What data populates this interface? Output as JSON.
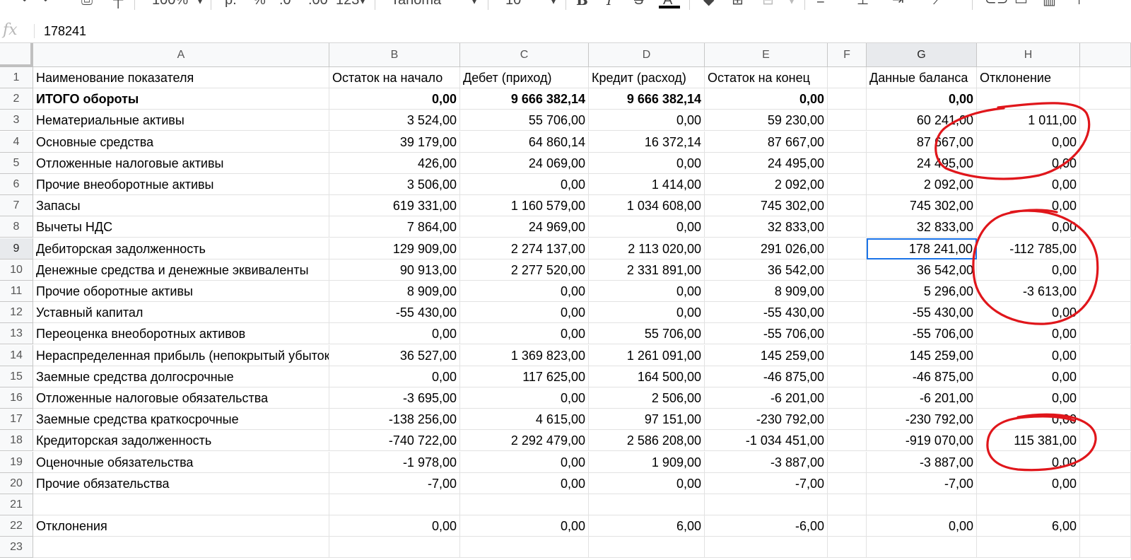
{
  "toolbar": {
    "zoom": "100%",
    "currency": "р.",
    "percent": "%",
    "dec_less": ".0",
    "dec_more": ".00",
    "number_format": "123",
    "font": "Tahoma",
    "font_size": "10",
    "bold": "B",
    "italic": "I",
    "strike": "S",
    "text_color": "A"
  },
  "formula_bar": {
    "fx": "fx",
    "value": "178241"
  },
  "columns": [
    {
      "id": "A",
      "label": "A"
    },
    {
      "id": "B",
      "label": "B"
    },
    {
      "id": "C",
      "label": "C"
    },
    {
      "id": "D",
      "label": "D"
    },
    {
      "id": "E",
      "label": "E"
    },
    {
      "id": "F",
      "label": "F"
    },
    {
      "id": "G",
      "label": "G"
    },
    {
      "id": "H",
      "label": "H"
    }
  ],
  "rows": [
    {
      "n": "1",
      "cells": [
        "Наименование показателя",
        "Остаток на начало",
        "Дебет (приход)",
        "Кредит (расход)",
        "Остаток на конец",
        "",
        "Данные баланса",
        "Отклонение"
      ]
    },
    {
      "n": "2",
      "cells": [
        "ИТОГО обороты",
        "0,00",
        "9 666 382,14",
        "9 666 382,14",
        "0,00",
        "",
        "0,00",
        ""
      ]
    },
    {
      "n": "3",
      "cells": [
        "Нематериальные активы",
        "3 524,00",
        "55 706,00",
        "0,00",
        "59 230,00",
        "",
        "60 241,00",
        "1 011,00"
      ]
    },
    {
      "n": "4",
      "cells": [
        "Основные средства",
        "39 179,00",
        "64 860,14",
        "16 372,14",
        "87 667,00",
        "",
        "87 667,00",
        "0,00"
      ]
    },
    {
      "n": "5",
      "cells": [
        "Отложенные налоговые активы",
        "426,00",
        "24 069,00",
        "0,00",
        "24 495,00",
        "",
        "24 495,00",
        "0,00"
      ]
    },
    {
      "n": "6",
      "cells": [
        "Прочие внеоборотные активы",
        "3 506,00",
        "0,00",
        "1 414,00",
        "2 092,00",
        "",
        "2 092,00",
        "0,00"
      ]
    },
    {
      "n": "7",
      "cells": [
        "Запасы",
        "619 331,00",
        "1 160 579,00",
        "1 034 608,00",
        "745 302,00",
        "",
        "745 302,00",
        "0,00"
      ]
    },
    {
      "n": "8",
      "cells": [
        "Вычеты НДС",
        "7 864,00",
        "24 969,00",
        "0,00",
        "32 833,00",
        "",
        "32 833,00",
        "0,00"
      ]
    },
    {
      "n": "9",
      "cells": [
        "Дебиторская задолженность",
        "129 909,00",
        "2 274 137,00",
        "2 113 020,00",
        "291 026,00",
        "",
        "178 241,00",
        "-112 785,00"
      ]
    },
    {
      "n": "10",
      "cells": [
        "Денежные средства и денежные эквиваленты",
        "90 913,00",
        "2 277 520,00",
        "2 331 891,00",
        "36 542,00",
        "",
        "36 542,00",
        "0,00"
      ]
    },
    {
      "n": "11",
      "cells": [
        "Прочие оборотные активы",
        "8 909,00",
        "0,00",
        "0,00",
        "8 909,00",
        "",
        "5 296,00",
        "-3 613,00"
      ]
    },
    {
      "n": "12",
      "cells": [
        "Уставный капитал",
        "-55 430,00",
        "0,00",
        "0,00",
        "-55 430,00",
        "",
        "-55 430,00",
        "0,00"
      ]
    },
    {
      "n": "13",
      "cells": [
        "Переоценка внеоборотных активов",
        "0,00",
        "0,00",
        "55 706,00",
        "-55 706,00",
        "",
        "-55 706,00",
        "0,00"
      ]
    },
    {
      "n": "14",
      "cells": [
        "Нераспределенная прибыль (непокрытый убыток)",
        "36 527,00",
        "1 369 823,00",
        "1 261 091,00",
        "145 259,00",
        "",
        "145 259,00",
        "0,00"
      ]
    },
    {
      "n": "15",
      "cells": [
        "Заемные средства долгосрочные",
        "0,00",
        "117 625,00",
        "164 500,00",
        "-46 875,00",
        "",
        "-46 875,00",
        "0,00"
      ]
    },
    {
      "n": "16",
      "cells": [
        "Отложенные налоговые обязательства",
        "-3 695,00",
        "0,00",
        "2 506,00",
        "-6 201,00",
        "",
        "-6 201,00",
        "0,00"
      ]
    },
    {
      "n": "17",
      "cells": [
        "Заемные средства краткосрочные",
        "-138 256,00",
        "4 615,00",
        "97 151,00",
        "-230 792,00",
        "",
        "-230 792,00",
        "0,00"
      ]
    },
    {
      "n": "18",
      "cells": [
        "Кредиторская задолженность",
        "-740 722,00",
        "2 292 479,00",
        "2 586 208,00",
        "-1 034 451,00",
        "",
        "-919 070,00",
        "115 381,00"
      ]
    },
    {
      "n": "19",
      "cells": [
        "Оценочные обязательства",
        "-1 978,00",
        "0,00",
        "1 909,00",
        "-3 887,00",
        "",
        "-3 887,00",
        "0,00"
      ]
    },
    {
      "n": "20",
      "cells": [
        "Прочие обязательства",
        "-7,00",
        "0,00",
        "0,00",
        "-7,00",
        "",
        "-7,00",
        "0,00"
      ]
    },
    {
      "n": "21",
      "cells": [
        "",
        "",
        "",
        "",
        "",
        "",
        "",
        ""
      ]
    },
    {
      "n": "22",
      "cells": [
        "Отклонения",
        "0,00",
        "0,00",
        "6,00",
        "-6,00",
        "",
        "0,00",
        "6,00"
      ]
    },
    {
      "n": "23",
      "cells": [
        "",
        "",
        "",
        "",
        "",
        "",
        "",
        ""
      ]
    }
  ],
  "selected_cell": "G9",
  "annotation_color": "#e0161b"
}
